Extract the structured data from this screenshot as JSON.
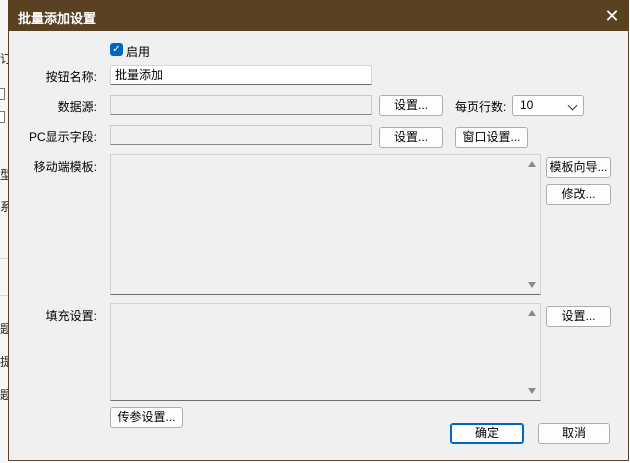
{
  "dialog": {
    "title": "批量添加设置",
    "close_icon": "close-icon"
  },
  "enable": {
    "checked": true,
    "label": "启用"
  },
  "button_name": {
    "label": "按钮名称:",
    "value": "批量添加"
  },
  "datasource": {
    "label": "数据源:",
    "value": "",
    "settings_button": "设置..."
  },
  "rows_per_page": {
    "label": "每页行数:",
    "value": "10"
  },
  "pc_fields": {
    "label": "PC显示字段:",
    "value": "",
    "settings_button": "设置...",
    "window_button": "窗口设置..."
  },
  "mobile_template": {
    "label": "移动端模板:",
    "wizard_button": "模板向导...",
    "edit_button": "修改..."
  },
  "fill_settings": {
    "label": "填充设置:",
    "settings_button": "设置..."
  },
  "pass_params_button": "传参设置...",
  "ok_button": "确定",
  "cancel_button": "取消",
  "background_window": {
    "fragments": [
      "订",
      "型",
      "系",
      "题",
      "提",
      "题"
    ]
  },
  "colors": {
    "titlebar": "#5a4122",
    "accent": "#0067c0",
    "dialog_bg": "#f0f0f0"
  }
}
